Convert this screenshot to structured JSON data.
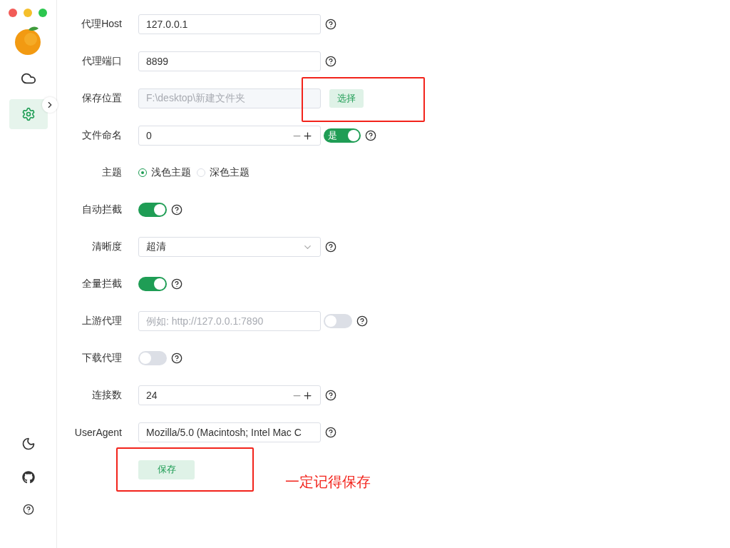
{
  "sidebar": {
    "items": [
      {
        "kind": "cloud",
        "selected": false
      },
      {
        "kind": "settings",
        "selected": true
      }
    ],
    "bottom": [
      {
        "kind": "moon"
      },
      {
        "kind": "github"
      },
      {
        "kind": "help"
      }
    ]
  },
  "rows": [
    {
      "label": "代理Host",
      "kind": "text",
      "value": "127.0.0.1",
      "help": true
    },
    {
      "label": "代理端口",
      "kind": "text",
      "value": "8899",
      "help": true
    },
    {
      "label": "保存位置",
      "kind": "path",
      "value": "F:\\desktop\\新建文件夹",
      "button": "选择",
      "disabled": true,
      "highlighted": true
    },
    {
      "label": "文件命名",
      "kind": "number",
      "value": "0",
      "switch": {
        "on": true,
        "text": "是"
      },
      "help": true
    },
    {
      "label": "主题",
      "kind": "radio",
      "options": [
        {
          "label": "浅色主题",
          "selected": true
        },
        {
          "label": "深色主题",
          "selected": false
        }
      ]
    },
    {
      "label": "自动拦截",
      "kind": "switch",
      "on": true,
      "help": true
    },
    {
      "label": "清晰度",
      "kind": "select",
      "value": "超清",
      "help": true
    },
    {
      "label": "全量拦截",
      "kind": "switch",
      "on": true,
      "help": true
    },
    {
      "label": "上游代理",
      "kind": "text",
      "placeholder": "例如: http://127.0.0.1:7890",
      "switch": {
        "on": false
      },
      "help": true
    },
    {
      "label": "下载代理",
      "kind": "switch",
      "on": false,
      "help": true
    },
    {
      "label": "连接数",
      "kind": "number",
      "value": "24",
      "help": true
    },
    {
      "label": "UserAgent",
      "kind": "text",
      "value": "Mozilla/5.0 (Macintosh; Intel Mac C",
      "help": true
    }
  ],
  "save_button": {
    "label": "保存",
    "highlighted": true
  },
  "note": "一定记得保存"
}
